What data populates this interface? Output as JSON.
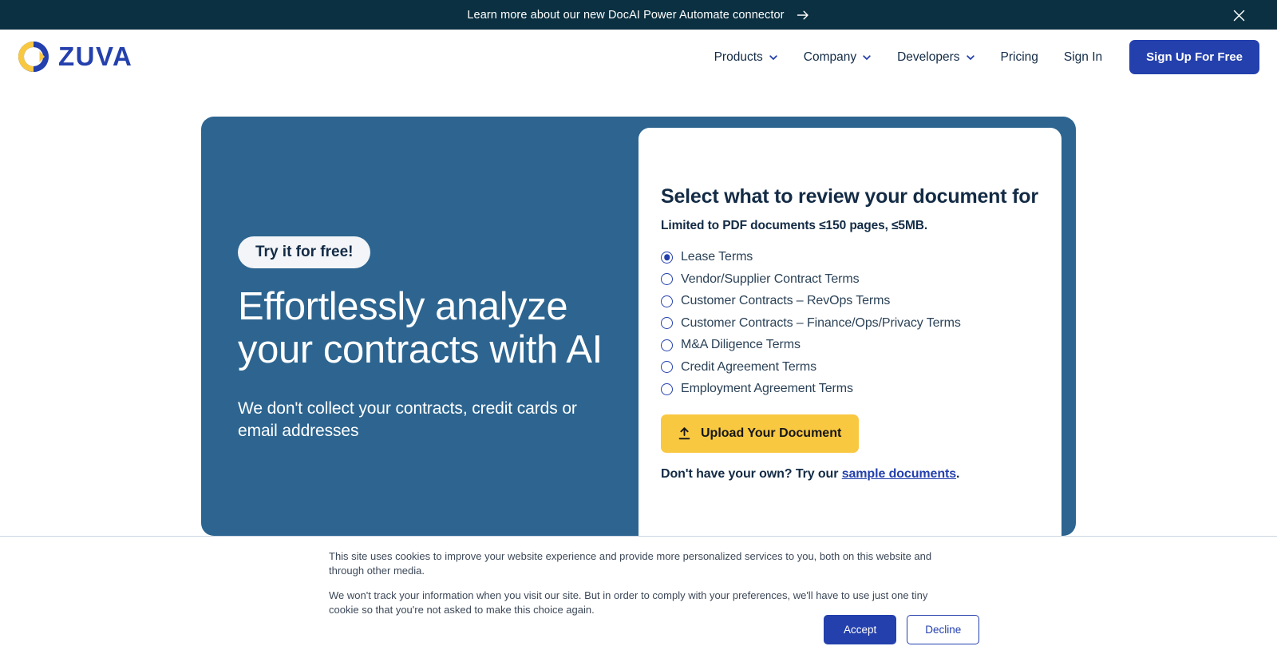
{
  "announcement": {
    "text": "Learn more about our new DocAI Power Automate connector",
    "arrow_icon": "arrow-right-icon",
    "close_icon": "close-icon",
    "background": "#0b3041"
  },
  "header": {
    "logo_text": "ZUVA",
    "logo_ring_color": "#2440ad",
    "logo_accent_color": "#f9c841",
    "nav": [
      {
        "label": "Products",
        "has_dropdown": true
      },
      {
        "label": "Company",
        "has_dropdown": true
      },
      {
        "label": "Developers",
        "has_dropdown": true
      },
      {
        "label": "Pricing",
        "has_dropdown": false
      },
      {
        "label": "Sign In",
        "has_dropdown": false
      }
    ],
    "cta_label": "Sign Up For Free",
    "cta_color": "#2440ad"
  },
  "hero": {
    "panel_color": "#2d6590",
    "pill_label": "Try it for free!",
    "title": "Effortlessly analyze your contracts with AI",
    "subtitle": "We don't collect your contracts, credit cards or email addresses"
  },
  "form_card": {
    "title": "Select what to review your document for",
    "subtitle": "Limited to PDF documents ≤150 pages, ≤5MB.",
    "options": [
      {
        "label": "Lease Terms",
        "selected": true
      },
      {
        "label": "Vendor/Supplier Contract Terms",
        "selected": false
      },
      {
        "label": "Customer Contracts – RevOps Terms",
        "selected": false
      },
      {
        "label": "Customer Contracts – Finance/Ops/Privacy Terms",
        "selected": false
      },
      {
        "label": "M&A Diligence Terms",
        "selected": false
      },
      {
        "label": "Credit Agreement Terms",
        "selected": false
      },
      {
        "label": "Employment Agreement Terms",
        "selected": false
      }
    ],
    "upload_label": "Upload Your Document",
    "upload_icon": "upload-icon",
    "upload_color": "#f9c841",
    "sample_prefix": "Don't have your own? Try our ",
    "sample_link": "sample documents",
    "sample_suffix": "."
  },
  "cookie_banner": {
    "paragraph1": "This site uses cookies to improve your website experience and provide more personalized services to you, both on this website and through other media.",
    "paragraph2": "We won't track your information when you visit our site. But in order to comply with your preferences, we'll have to use just one tiny cookie so that you're not asked to make this choice again.",
    "accept_label": "Accept",
    "decline_label": "Decline"
  }
}
